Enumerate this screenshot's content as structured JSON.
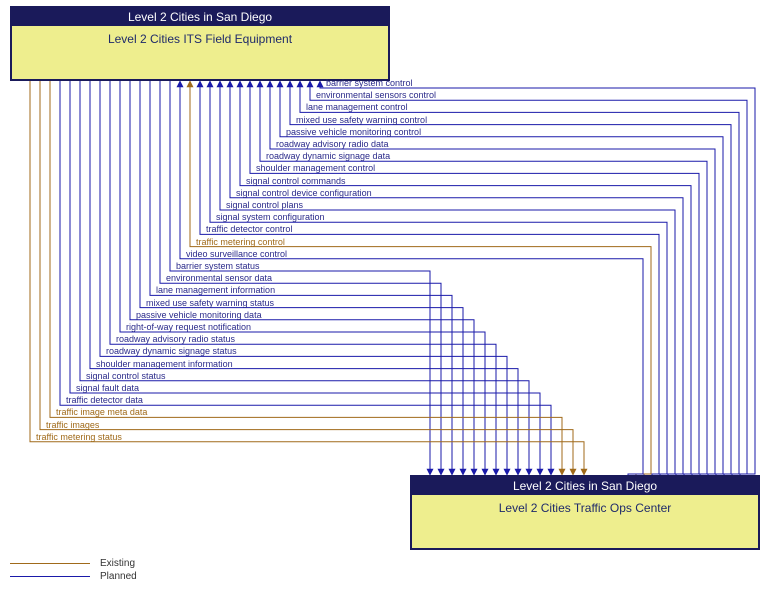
{
  "box_a": {
    "header": "Level 2 Cities in San Diego",
    "body": "Level 2 Cities ITS Field Equipment"
  },
  "box_b": {
    "header": "Level 2 Cities in San Diego",
    "body": "Level 2 Cities Traffic Ops Center"
  },
  "legend": {
    "existing": "Existing",
    "planned": "Planned"
  },
  "chart_data": {
    "type": "diagram",
    "title": "",
    "nodes": [
      {
        "id": "A",
        "label": "Level 2 Cities ITS Field Equipment",
        "group": "Level 2 Cities in San Diego"
      },
      {
        "id": "B",
        "label": "Level 2 Cities Traffic Ops Center",
        "group": "Level 2 Cities in San Diego"
      }
    ],
    "flows": [
      {
        "label": "barrier system control",
        "from": "B",
        "to": "A",
        "status": "planned"
      },
      {
        "label": "environmental sensors control",
        "from": "B",
        "to": "A",
        "status": "planned"
      },
      {
        "label": "lane management control",
        "from": "B",
        "to": "A",
        "status": "planned"
      },
      {
        "label": "mixed use safety warning control",
        "from": "B",
        "to": "A",
        "status": "planned"
      },
      {
        "label": "passive vehicle monitoring control",
        "from": "B",
        "to": "A",
        "status": "planned"
      },
      {
        "label": "roadway advisory radio data",
        "from": "B",
        "to": "A",
        "status": "planned"
      },
      {
        "label": "roadway dynamic signage data",
        "from": "B",
        "to": "A",
        "status": "planned"
      },
      {
        "label": "shoulder management control",
        "from": "B",
        "to": "A",
        "status": "planned"
      },
      {
        "label": "signal control commands",
        "from": "B",
        "to": "A",
        "status": "planned"
      },
      {
        "label": "signal control device configuration",
        "from": "B",
        "to": "A",
        "status": "planned"
      },
      {
        "label": "signal control plans",
        "from": "B",
        "to": "A",
        "status": "planned"
      },
      {
        "label": "signal system configuration",
        "from": "B",
        "to": "A",
        "status": "planned"
      },
      {
        "label": "traffic detector control",
        "from": "B",
        "to": "A",
        "status": "planned"
      },
      {
        "label": "traffic metering control",
        "from": "B",
        "to": "A",
        "status": "existing"
      },
      {
        "label": "video surveillance control",
        "from": "B",
        "to": "A",
        "status": "planned"
      },
      {
        "label": "barrier system status",
        "from": "A",
        "to": "B",
        "status": "planned"
      },
      {
        "label": "environmental sensor data",
        "from": "A",
        "to": "B",
        "status": "planned"
      },
      {
        "label": "lane management information",
        "from": "A",
        "to": "B",
        "status": "planned"
      },
      {
        "label": "mixed use safety warning status",
        "from": "A",
        "to": "B",
        "status": "planned"
      },
      {
        "label": "passive vehicle monitoring data",
        "from": "A",
        "to": "B",
        "status": "planned"
      },
      {
        "label": "right-of-way request notification",
        "from": "A",
        "to": "B",
        "status": "planned"
      },
      {
        "label": "roadway advisory radio status",
        "from": "A",
        "to": "B",
        "status": "planned"
      },
      {
        "label": "roadway dynamic signage status",
        "from": "A",
        "to": "B",
        "status": "planned"
      },
      {
        "label": "shoulder management information",
        "from": "A",
        "to": "B",
        "status": "planned"
      },
      {
        "label": "signal control status",
        "from": "A",
        "to": "B",
        "status": "planned"
      },
      {
        "label": "signal fault data",
        "from": "A",
        "to": "B",
        "status": "planned"
      },
      {
        "label": "traffic detector data",
        "from": "A",
        "to": "B",
        "status": "planned"
      },
      {
        "label": "traffic image meta data",
        "from": "A",
        "to": "B",
        "status": "existing"
      },
      {
        "label": "traffic images",
        "from": "A",
        "to": "B",
        "status": "existing"
      },
      {
        "label": "traffic metering status",
        "from": "A",
        "to": "B",
        "status": "existing"
      }
    ]
  }
}
